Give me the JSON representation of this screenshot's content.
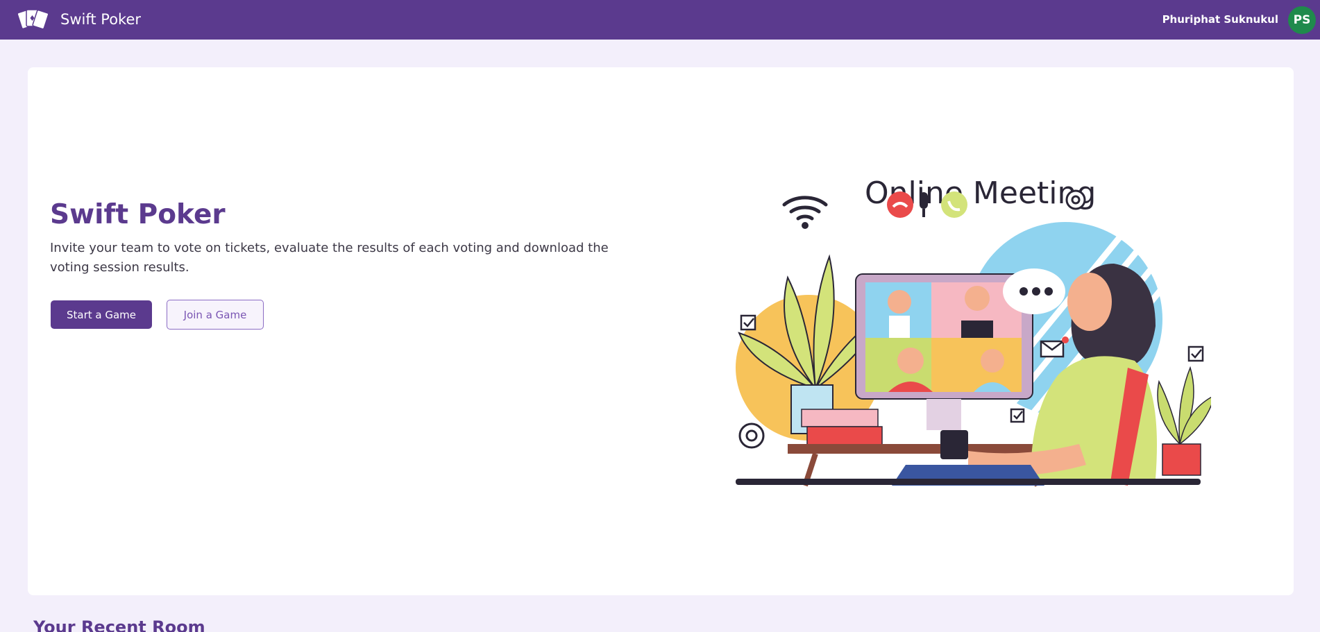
{
  "header": {
    "brand_name": "Swift Poker",
    "user_name": "Phuriphat Suknukul",
    "avatar_initials": "PS",
    "colors": {
      "bar": "#5b3a8e",
      "avatar": "#1f8a4c"
    }
  },
  "hero": {
    "title": "Swift Poker",
    "description": "Invite your team to vote on tickets, evaluate the results of each voting and download the voting session results.",
    "start_button_label": "Start a Game",
    "join_button_label": "Join a Game",
    "illustration_title": "Online Meeting"
  },
  "recent": {
    "title": "Your Recent Room"
  },
  "icons": {
    "brand": "playing-cards-icon"
  }
}
